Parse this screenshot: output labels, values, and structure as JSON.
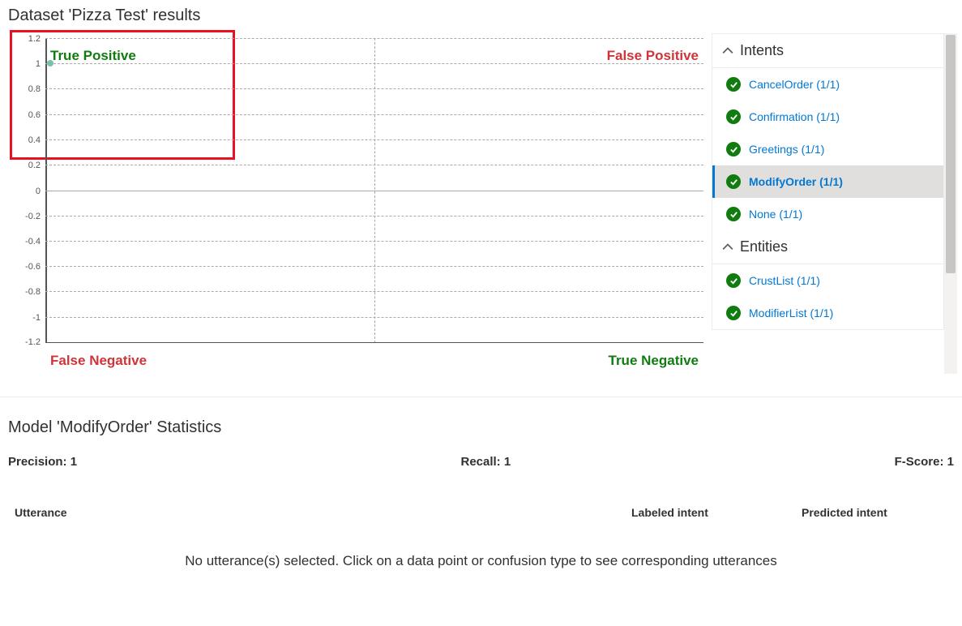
{
  "title": "Dataset 'Pizza Test' results",
  "chart_data": {
    "type": "scatter",
    "ylabel": "",
    "xlabel": "",
    "y_ticks": [
      "1.2",
      "1",
      "0.8",
      "0.6",
      "0.4",
      "0.2",
      "0",
      "-0.2",
      "-0.4",
      "-0.6",
      "-0.8",
      "-1",
      "-1.2"
    ],
    "ylim": [
      -1.2,
      1.2
    ],
    "quadrants": {
      "tp": "True Positive",
      "fp": "False Positive",
      "fn": "False Negative",
      "tn": "True Negative"
    },
    "series": [
      {
        "name": "ModifyOrder",
        "points": [
          {
            "x": 0.02,
            "y": 1
          }
        ]
      }
    ]
  },
  "sidebar": {
    "sections": [
      {
        "title": "Intents",
        "items": [
          {
            "label": "CancelOrder (1/1)",
            "selected": false
          },
          {
            "label": "Confirmation (1/1)",
            "selected": false
          },
          {
            "label": "Greetings (1/1)",
            "selected": false
          },
          {
            "label": "ModifyOrder (1/1)",
            "selected": true
          },
          {
            "label": "None (1/1)",
            "selected": false
          }
        ]
      },
      {
        "title": "Entities",
        "items": [
          {
            "label": "CrustList (1/1)",
            "selected": false
          },
          {
            "label": "ModifierList (1/1)",
            "selected": false
          }
        ]
      }
    ]
  },
  "stats": {
    "title": "Model 'ModifyOrder' Statistics",
    "precision_label": "Precision: 1",
    "recall_label": "Recall: 1",
    "fscore_label": "F-Score: 1"
  },
  "table": {
    "col_utterance": "Utterance",
    "col_labeled": "Labeled intent",
    "col_predicted": "Predicted intent",
    "empty": "No utterance(s) selected. Click on a data point or confusion type to see corresponding utterances"
  }
}
